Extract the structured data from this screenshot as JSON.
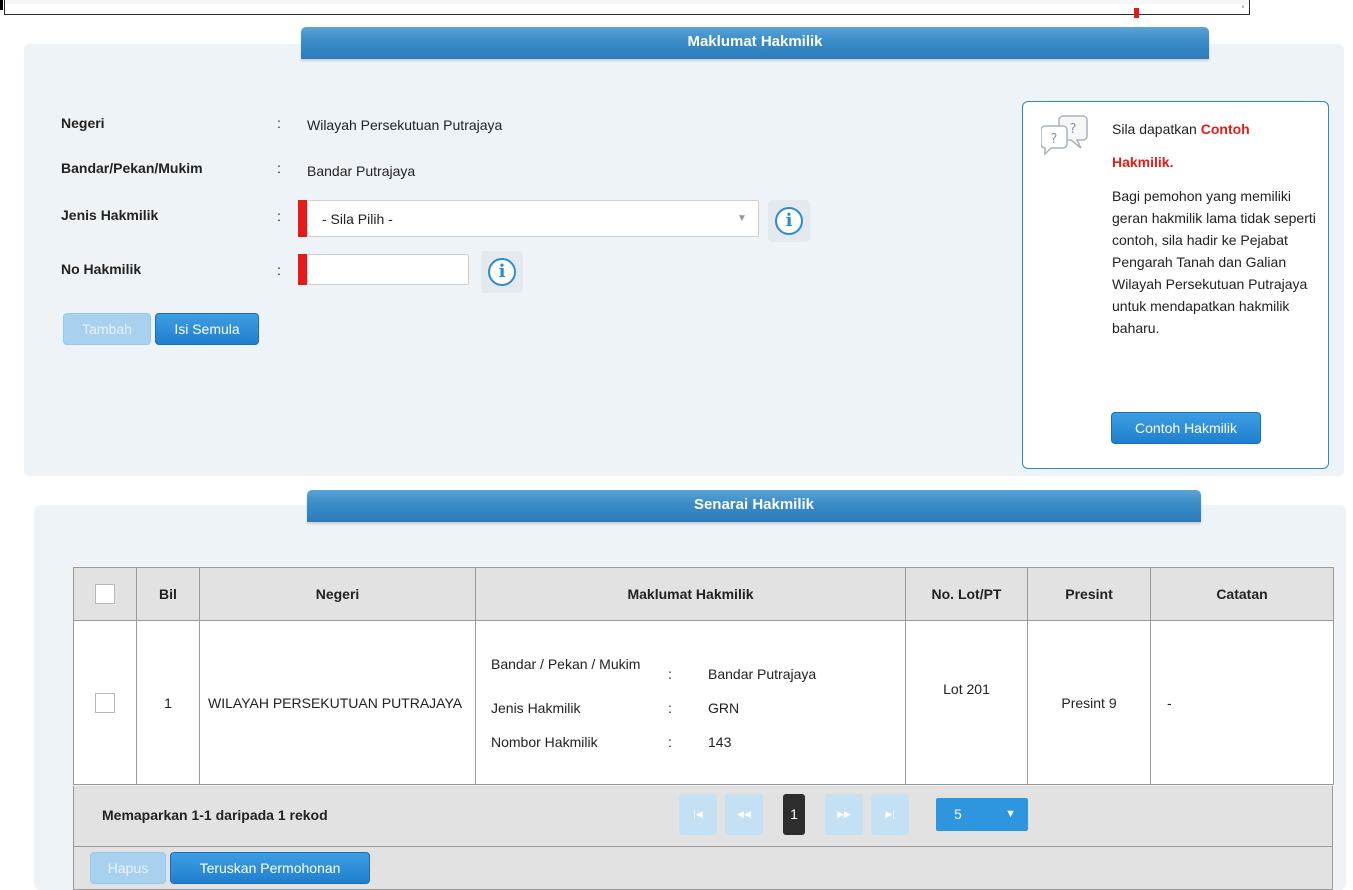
{
  "top_marker_text": "'",
  "panel1": {
    "title": "Maklumat Hakmilik",
    "fields": {
      "negeri": {
        "label": "Negeri",
        "colon": ":",
        "value": "Wilayah Persekutuan Putrajaya"
      },
      "bandar": {
        "label": "Bandar/Pekan/Mukim",
        "colon": ":",
        "value": "Bandar Putrajaya"
      },
      "jenis": {
        "label": "Jenis Hakmilik",
        "colon": ":",
        "selected": "- Sila Pilih -"
      },
      "no": {
        "label": "No Hakmilik",
        "colon": ":",
        "value": ""
      }
    },
    "buttons": {
      "tambah": "Tambah",
      "isi_semula": "Isi Semula"
    },
    "help": {
      "lead": "Sila dapatkan ",
      "highlight1": "Contoh",
      "highlight2": "Hakmilik.",
      "body": "Bagi pemohon yang memiliki geran hakmilik lama tidak seperti contoh, sila hadir ke Pejabat Pengarah Tanah dan Galian Wilayah Persekutuan Putrajaya untuk mendapatkan hakmilik baharu.",
      "button": "Contoh Hakmilik"
    }
  },
  "panel2": {
    "title": "Senarai Hakmilik",
    "columns": [
      "Bil",
      "Negeri",
      "Maklumat Hakmilik",
      "No. Lot/PT",
      "Presint",
      "Catatan"
    ],
    "rows": [
      {
        "bil": "1",
        "negeri": "WILAYAH PERSEKUTUAN PUTRAJAYA",
        "details": [
          {
            "label": "Bandar / Pekan / Mukim",
            "sep": ":",
            "value": "Bandar Putrajaya"
          },
          {
            "label": "Jenis Hakmilik",
            "sep": ":",
            "value": "GRN"
          },
          {
            "label": "Nombor Hakmilik",
            "sep": ":",
            "value": "143"
          }
        ],
        "lot": "Lot 201",
        "presint": "Presint 9",
        "catatan": "-"
      }
    ],
    "footer_text": "Memaparkan 1-1 daripada 1 rekod",
    "pagination": {
      "current_page": "1",
      "page_size": "5",
      "first": "|◀",
      "prev": "◀◀",
      "next": "▶▶",
      "last": "▶|"
    },
    "buttons": {
      "hapus": "Hapus",
      "teruskan": "Teruskan Permohonan"
    }
  }
}
